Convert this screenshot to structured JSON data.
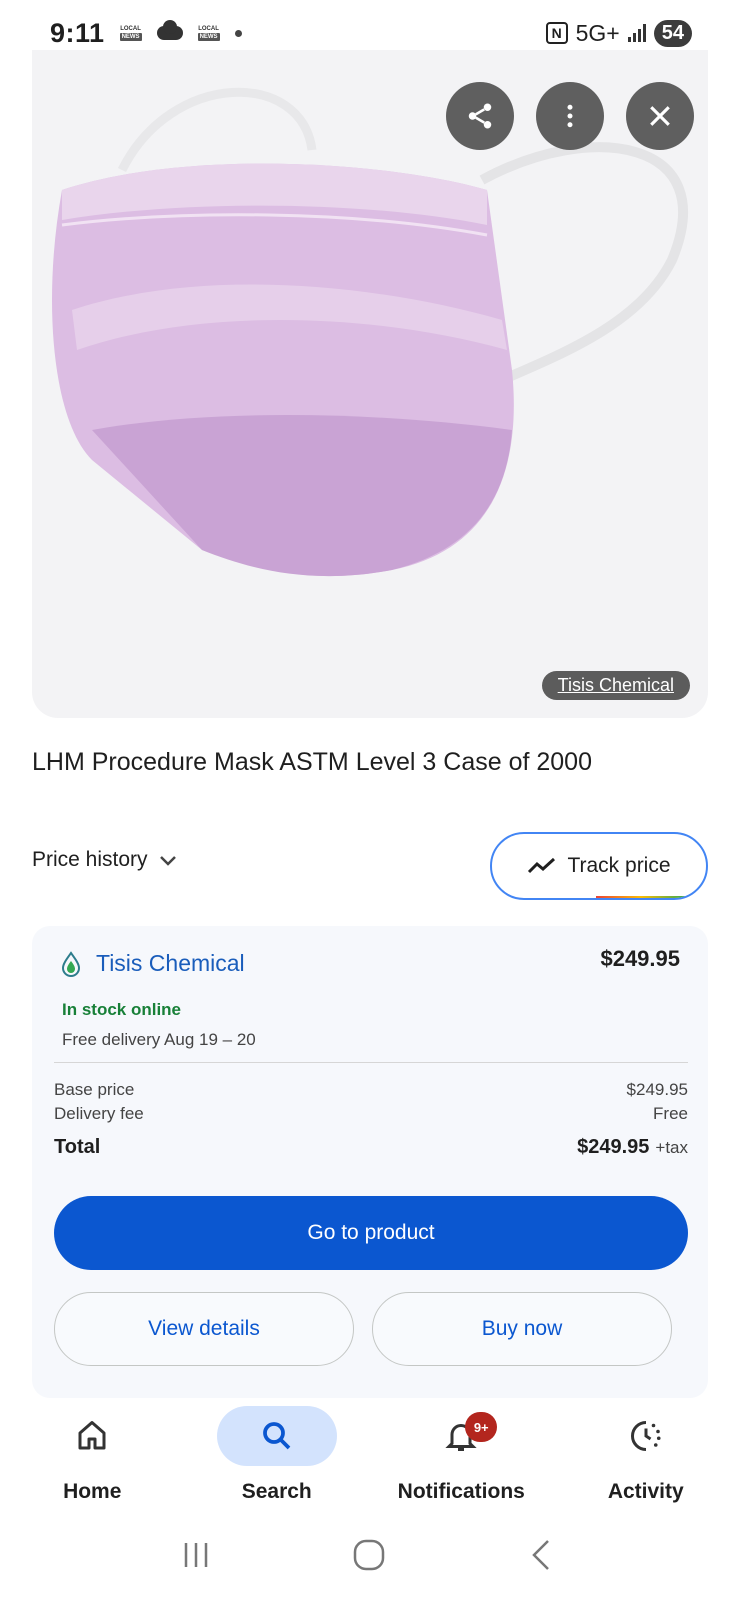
{
  "status_bar": {
    "time": "9:11",
    "news_badge_1": {
      "top": "LOCAL",
      "bottom": "NEWS"
    },
    "news_badge_2": {
      "top": "LOCAL",
      "bottom": "NEWS"
    },
    "nfc": "N",
    "network": "5G+",
    "battery": "54"
  },
  "image": {
    "source_label": "Tisis Chemical",
    "mask_color": "#d9b8e0"
  },
  "product": {
    "title": "LHM Procedure Mask ASTM Level 3 Case of 2000"
  },
  "price_history": {
    "label": "Price history"
  },
  "track_price": {
    "label": "Track price"
  },
  "offer": {
    "seller": "Tisis Chemical",
    "price": "$249.95",
    "stock": "In stock online",
    "delivery": "Free delivery Aug 19 – 20",
    "base_price_label": "Base price",
    "base_price_value": "$249.95",
    "delivery_fee_label": "Delivery fee",
    "delivery_fee_value": "Free",
    "total_label": "Total",
    "total_value": "$249.95",
    "tax_label": "+tax",
    "go_button": "Go to product",
    "view_details_button": "View details",
    "buy_now_button": "Buy now"
  },
  "bottom_nav": {
    "home": "Home",
    "search": "Search",
    "notifications": "Notifications",
    "notifications_badge": "9+",
    "activity": "Activity"
  },
  "colors": {
    "accent_blue": "#0b57d0",
    "link_blue": "#1a5dbb",
    "stock_green": "#188038",
    "badge_red": "#b3261e"
  }
}
